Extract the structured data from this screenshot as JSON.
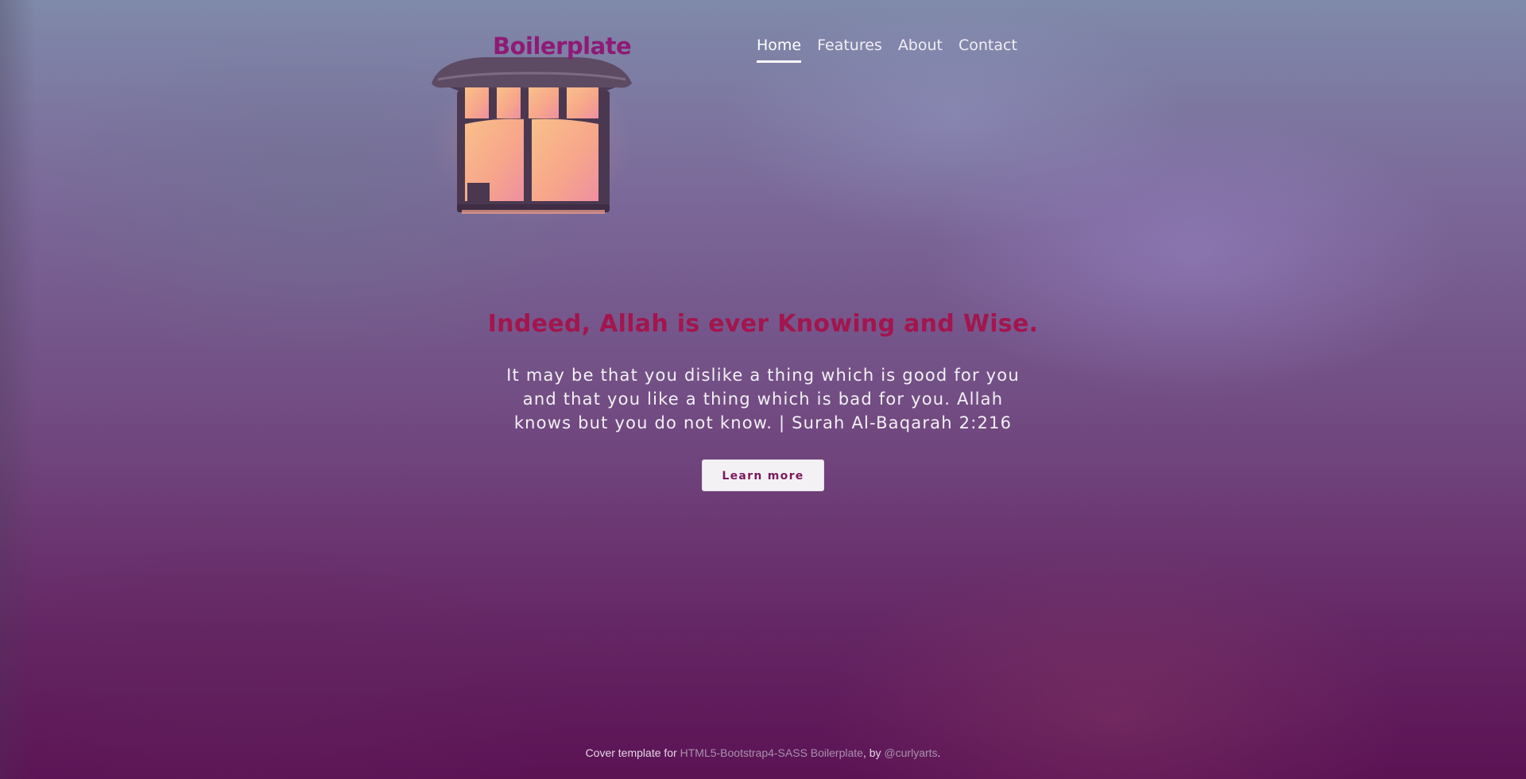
{
  "header": {
    "brand": "Boilerplate",
    "nav": [
      {
        "label": "Home",
        "active": true
      },
      {
        "label": "Features",
        "active": false
      },
      {
        "label": "About",
        "active": false
      },
      {
        "label": "Contact",
        "active": false
      }
    ]
  },
  "hero": {
    "title": "Indeed, Allah is ever Knowing and Wise.",
    "lead": "It may be that you dislike a thing which is good for you and that you like a thing which is bad for you. Allah knows but you do not know. | Surah Al-Baqarah 2:216",
    "button_label": "Learn more"
  },
  "footer": {
    "prefix": "Cover template for ",
    "link1": "HTML5-Bootstrap4-SASS Boilerplate",
    "middle": ", by ",
    "link2": "@curlyarts",
    "suffix": "."
  },
  "colors": {
    "brand": "#8e1a76",
    "hero_title": "#a3154e",
    "button_text": "#7a1a5c",
    "lantern_glow": "#f7b08a"
  },
  "icons": {
    "background_decoration": "lantern-illustration"
  }
}
